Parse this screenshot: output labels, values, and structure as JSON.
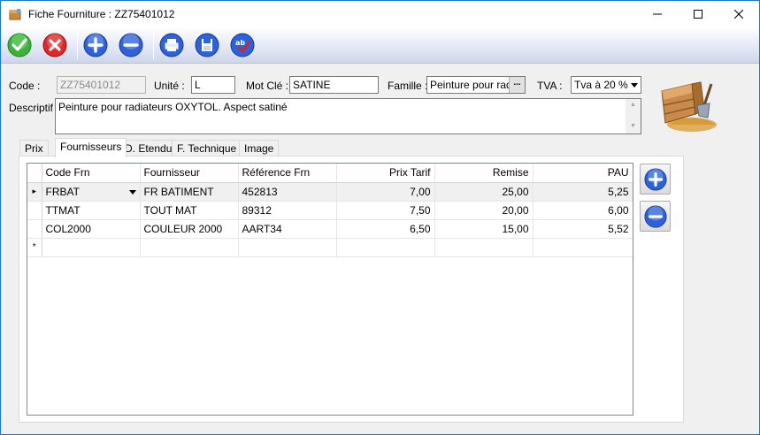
{
  "window": {
    "title": "Fiche Fourniture : ZZ75401012",
    "icon": "box-icon",
    "controls": [
      "minimize-icon",
      "maximize-icon",
      "close-icon"
    ]
  },
  "toolbar": {
    "buttons": [
      {
        "name": "validate",
        "icon": "check-icon",
        "color": "#2fa52f"
      },
      {
        "name": "cancel",
        "icon": "x-icon",
        "color": "#d62020"
      },
      {
        "name": "add",
        "icon": "plus-icon",
        "color": "#2a5fd6"
      },
      {
        "name": "remove",
        "icon": "minus-icon",
        "color": "#2a5fd6"
      },
      {
        "name": "print",
        "icon": "printer-icon",
        "color": "#2a5fd6"
      },
      {
        "name": "save",
        "icon": "floppy-disk-icon",
        "color": "#2a5fd6"
      },
      {
        "name": "spellcheck",
        "icon": "spellcheck-icon",
        "color": "#2a5fd6"
      }
    ]
  },
  "form": {
    "code_label": "Code :",
    "code_value": "ZZ75401012",
    "unite_label": "Unité :",
    "unite_value": "L",
    "motcle_label": "Mot Clé :",
    "motcle_value": "SATINE",
    "famille_label": "Famille :",
    "famille_value": "Peinture pour radiateurs",
    "famille_button": "...",
    "tva_label": "TVA :",
    "tva_value": "Tva à 20 %",
    "descriptif_label": "Descriptif :",
    "descriptif_value": "Peinture pour radiateurs OXYTOL. Aspect satiné"
  },
  "tabs": [
    "Prix",
    "Fournisseurs",
    "D. Etendu",
    "F. Technique",
    "Image"
  ],
  "active_tab": "Fournisseurs",
  "grid": {
    "columns": [
      "Code Frn",
      "Fournisseur",
      "Référence Frn",
      "Prix Tarif",
      "Remise",
      "PAU"
    ],
    "rows": [
      {
        "code": "FRBAT",
        "fournisseur": "FR BATIMENT",
        "reference": "452813",
        "prix": "7,00",
        "remise": "25,00",
        "pau": "5,25"
      },
      {
        "code": "TTMAT",
        "fournisseur": "TOUT MAT",
        "reference": "89312",
        "prix": "7,50",
        "remise": "20,00",
        "pau": "6,00"
      },
      {
        "code": "COL2000",
        "fournisseur": "COULEUR 2000",
        "reference": "AART34",
        "prix": "6,50",
        "remise": "15,00",
        "pau": "5,52"
      }
    ],
    "current_row_marker": "▸",
    "new_row_marker": "*"
  },
  "side_buttons": [
    {
      "name": "add-row",
      "icon": "plus-icon"
    },
    {
      "name": "remove-row",
      "icon": "minus-icon"
    }
  ],
  "decoration": {
    "icon": "crate-and-trowel-icon"
  }
}
